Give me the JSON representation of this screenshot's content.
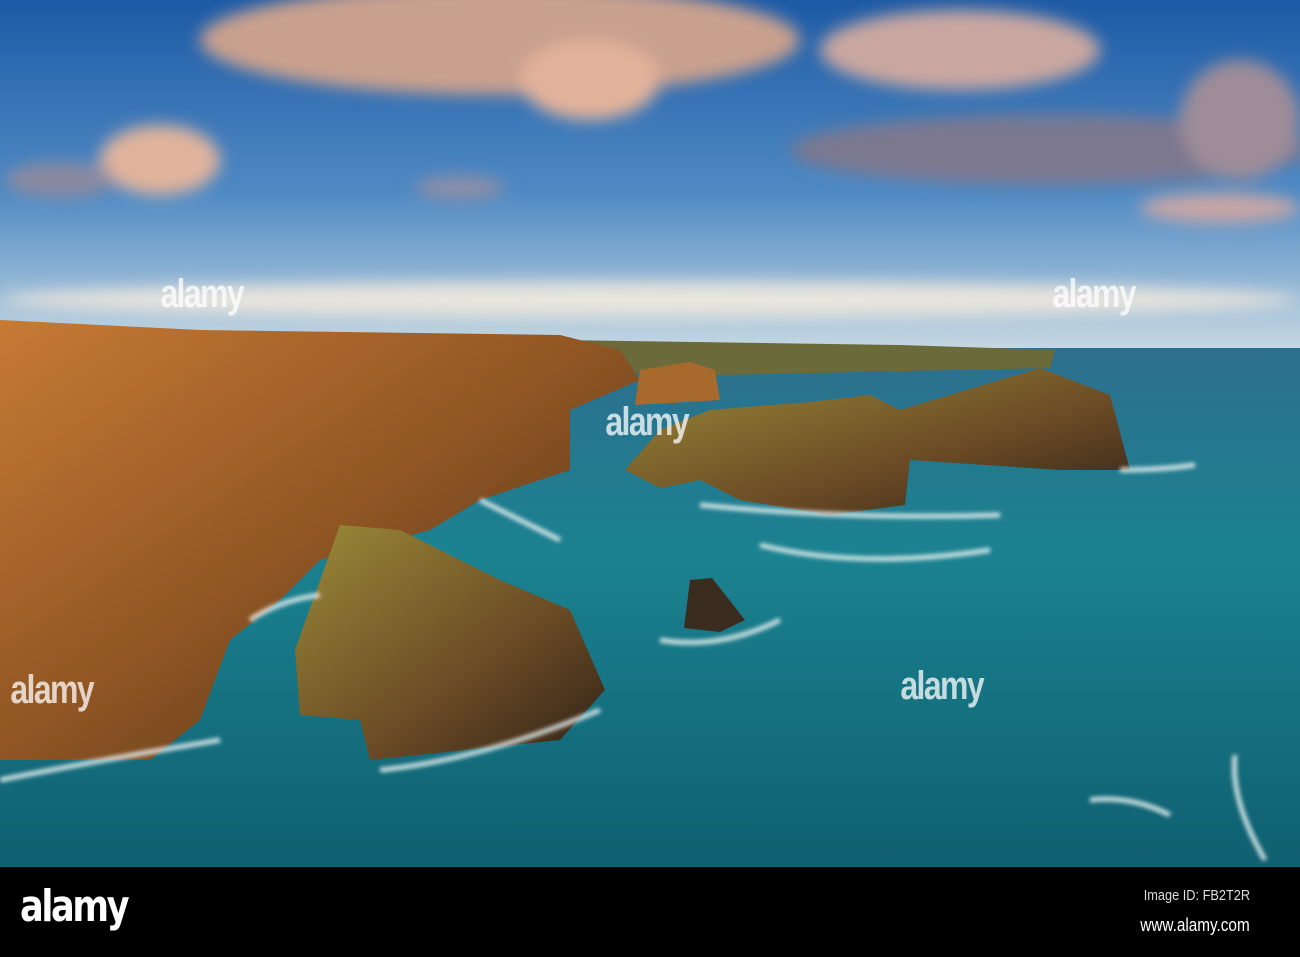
{
  "photo": {
    "subject": "coastal cliffs and sea stacks at sunset",
    "colors": {
      "sky_top": "#1f5fa8",
      "sky_horizon": "#bcd3e0",
      "sea": "#1a7f8c",
      "cliff": "#b8702c",
      "clouds": "#d9a88f"
    }
  },
  "watermark": {
    "text": "alamy"
  },
  "footer": {
    "logo": "alamy",
    "image_id": "Image ID: FB2T2R",
    "url": "www.alamy.com"
  }
}
